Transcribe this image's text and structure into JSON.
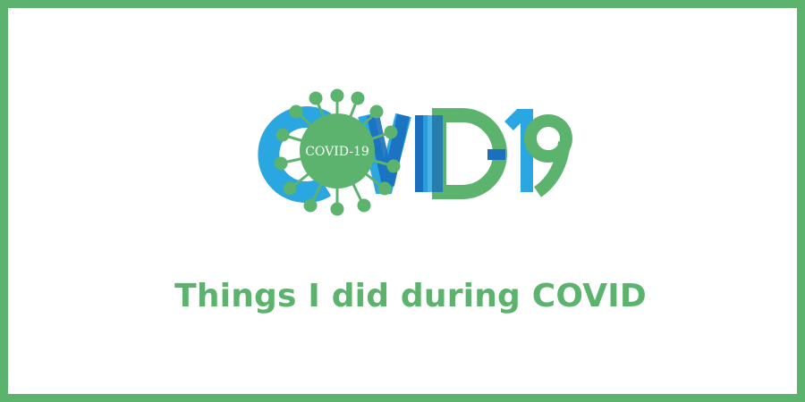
{
  "logo": {
    "virus_label": "COVID-19",
    "wordmark": "COVID-19"
  },
  "caption": {
    "text": "Things I did during COVID"
  },
  "colors": {
    "border_green": "#5bb36e",
    "blue_light": "#2aa6e0",
    "blue_dark": "#1a6fbe",
    "green": "#5bb36e"
  }
}
